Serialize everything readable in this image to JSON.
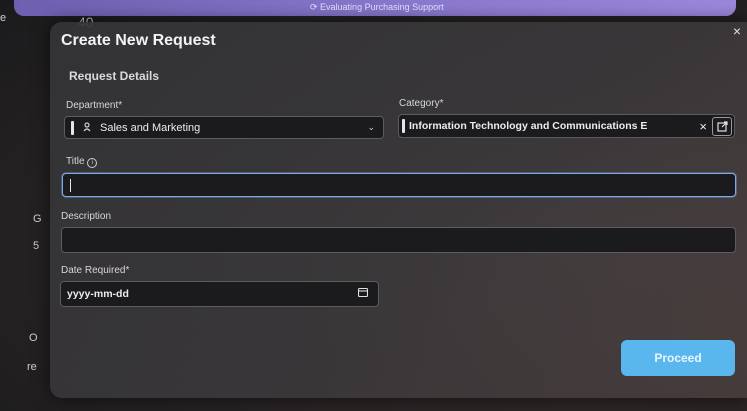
{
  "background": {
    "topbar_text": "⟳ Evaluating Purchasing Support",
    "counter": "40",
    "left_letters": [
      "e",
      "G",
      "5",
      "O",
      "re"
    ]
  },
  "modal": {
    "title": "Create New Request",
    "section_heading": "Request Details",
    "close_label": "×",
    "department": {
      "label": "Department",
      "required": "*",
      "value": "Sales and Marketing",
      "icon": "person-icon"
    },
    "category": {
      "label": "Category",
      "required": "*",
      "value": "Information Technology and Communications E",
      "clear_label": "×",
      "icon": "external-link-icon"
    },
    "title_field": {
      "label": "Title",
      "value": ""
    },
    "description": {
      "label": "Description",
      "value": ""
    },
    "date_required": {
      "label": "Date Required",
      "required": "*",
      "placeholder": "yyyy-mm-dd",
      "icon": "calendar-icon"
    },
    "proceed_label": "Proceed"
  },
  "colors": {
    "accent": "#5ab7ee",
    "focus": "#7fa8e6",
    "topbar": "#8c7ad0"
  }
}
